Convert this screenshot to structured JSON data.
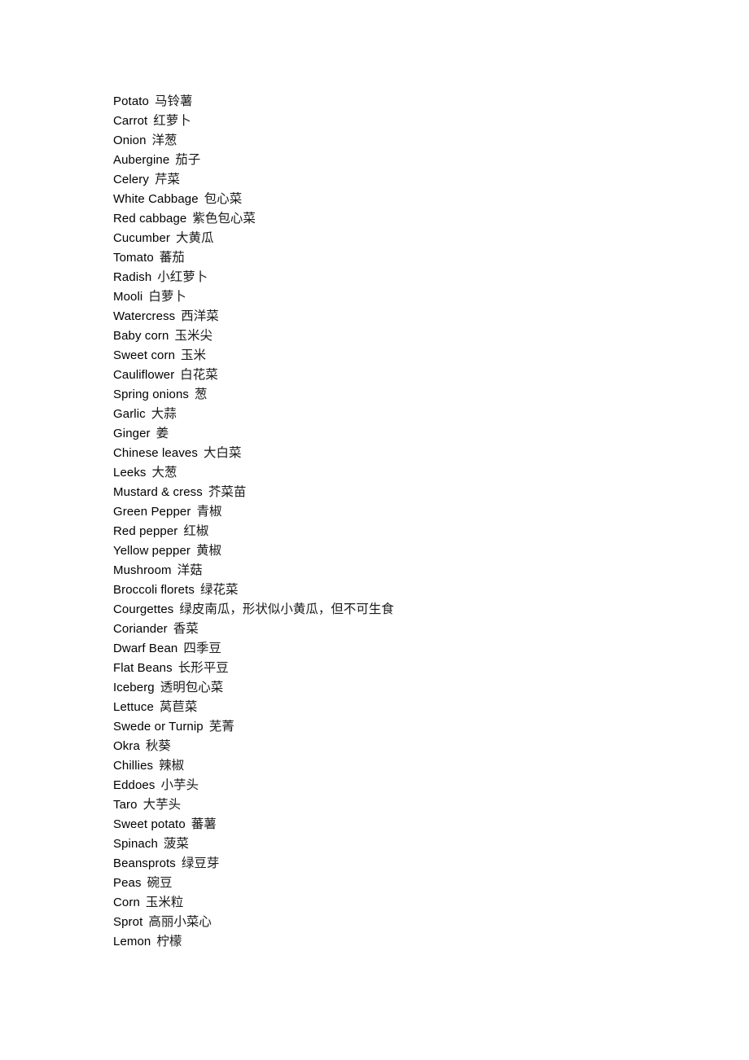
{
  "document": {
    "type": "bilingual-glossary",
    "language_pair": "English-Chinese",
    "background_color": "#ffffff",
    "text_color": "#000000",
    "entry_count": 44
  },
  "entries": [
    {
      "en": "Potato",
      "zh": "马铃薯"
    },
    {
      "en": "Carrot",
      "zh": "红萝卜"
    },
    {
      "en": "Onion",
      "zh": "洋葱"
    },
    {
      "en": "Aubergine",
      "zh": "茄子"
    },
    {
      "en": "Celery",
      "zh": "芹菜"
    },
    {
      "en": "White Cabbage",
      "zh": "包心菜"
    },
    {
      "en": "Red cabbage",
      "zh": "紫色包心菜"
    },
    {
      "en": "Cucumber",
      "zh": "大黄瓜"
    },
    {
      "en": "Tomato",
      "zh": "蕃茄"
    },
    {
      "en": "Radish",
      "zh": "小红萝卜"
    },
    {
      "en": "Mooli",
      "zh": "白萝卜"
    },
    {
      "en": "Watercress",
      "zh": "西洋菜"
    },
    {
      "en": "Baby corn",
      "zh": "玉米尖"
    },
    {
      "en": "Sweet corn",
      "zh": "玉米"
    },
    {
      "en": "Cauliflower",
      "zh": "白花菜"
    },
    {
      "en": "Spring onions",
      "zh": "葱"
    },
    {
      "en": "Garlic",
      "zh": "大蒜"
    },
    {
      "en": "Ginger",
      "zh": "姜"
    },
    {
      "en": "Chinese leaves",
      "zh": "大白菜"
    },
    {
      "en": "Leeks",
      "zh": "大葱"
    },
    {
      "en": "Mustard & cress",
      "zh": "芥菜苗"
    },
    {
      "en": "Green Pepper",
      "zh": "青椒"
    },
    {
      "en": "Red pepper",
      "zh": "红椒"
    },
    {
      "en": "Yellow pepper",
      "zh": "黄椒"
    },
    {
      "en": "Mushroom",
      "zh": "洋菇"
    },
    {
      "en": "Broccoli florets",
      "zh": "绿花菜"
    },
    {
      "en": "Courgettes",
      "zh": "绿皮南瓜，形状似小黄瓜，但不可生食"
    },
    {
      "en": "Coriander",
      "zh": "香菜"
    },
    {
      "en": "Dwarf Bean",
      "zh": "四季豆"
    },
    {
      "en": "Flat Beans",
      "zh": "长形平豆"
    },
    {
      "en": "Iceberg",
      "zh": "透明包心菜"
    },
    {
      "en": "Lettuce",
      "zh": "莴苣菜"
    },
    {
      "en": "Swede or Turnip",
      "zh": "芜菁"
    },
    {
      "en": "Okra",
      "zh": "秋葵"
    },
    {
      "en": "Chillies",
      "zh": "辣椒"
    },
    {
      "en": "Eddoes",
      "zh": "小芋头"
    },
    {
      "en": "Taro",
      "zh": "大芋头"
    },
    {
      "en": "Sweet potato",
      "zh": "蕃薯"
    },
    {
      "en": "Spinach",
      "zh": "菠菜"
    },
    {
      "en": "Beansprots",
      "zh": "绿豆芽"
    },
    {
      "en": "Peas",
      "zh": "碗豆"
    },
    {
      "en": "Corn",
      "zh": "玉米粒"
    },
    {
      "en": "Sprot",
      "zh": "高丽小菜心"
    },
    {
      "en": "Lemon",
      "zh": "柠檬"
    }
  ]
}
